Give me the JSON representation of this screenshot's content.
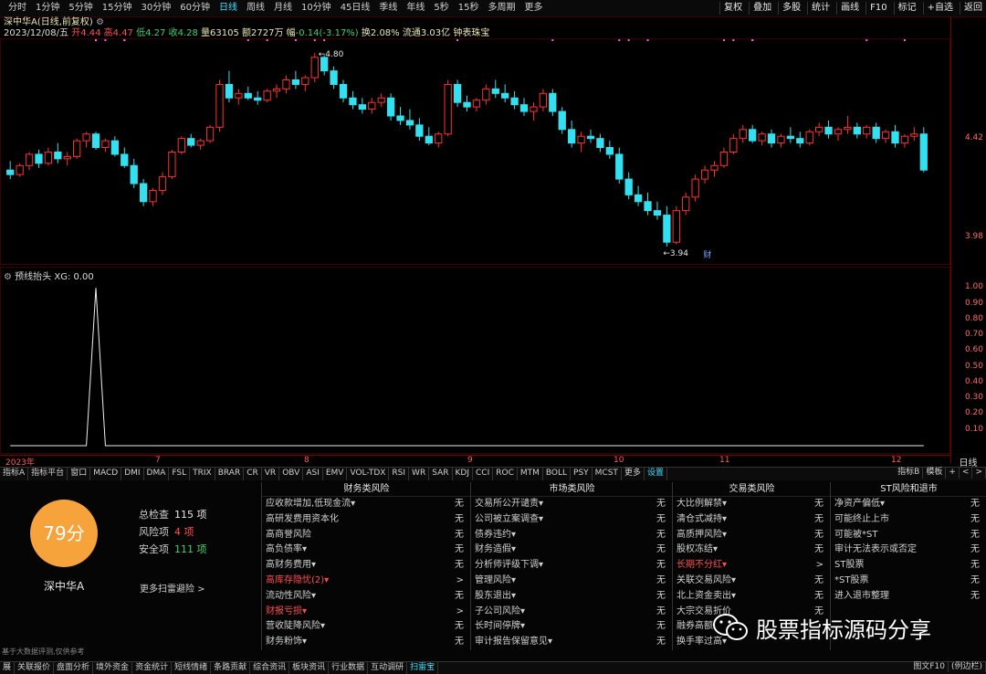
{
  "topbar": {
    "periods": [
      "分时",
      "1分钟",
      "5分钟",
      "15分钟",
      "30分钟",
      "60分钟",
      "日线",
      "周线",
      "月线",
      "10分钟",
      "45日线",
      "季线",
      "年线",
      "5秒",
      "15秒",
      "多周期",
      "更多"
    ],
    "active_period": "日线",
    "tools": [
      "复权",
      "叠加",
      "多股",
      "统计",
      "画线",
      "F10",
      "标记",
      "+自选",
      "返回"
    ]
  },
  "info": {
    "title": "深中华A(日线,前复权)",
    "date": "2023/12/08/五",
    "open_label": "开",
    "open": "4.44",
    "high_label": "高",
    "high": "4.47",
    "low_label": "低",
    "low": "4.27",
    "close_label": "收",
    "close": "4.28",
    "volume_label": "量",
    "volume": "63105",
    "amount_label": "额",
    "amount": "2727万",
    "change_label": "幅",
    "change": "-0.14(-3.17%)",
    "turnover_label": "换",
    "turnover": "2.08%",
    "float_label": "流通",
    "float": "3.03亿",
    "tag": "钟表珠宝"
  },
  "main_chart": {
    "high_marker": "4.80",
    "low_marker": "3.94",
    "fin_badge": "财",
    "y_labels": [
      "4.42",
      "3.98"
    ]
  },
  "sub_chart": {
    "title": "预线抬头",
    "xg_label": "XG: 0.00",
    "y_labels": [
      "1.00",
      "0.90",
      "0.80",
      "0.70",
      "0.60",
      "0.50",
      "0.40",
      "0.30",
      "0.20",
      "0.10"
    ]
  },
  "x_axis": {
    "labels": [
      "2023年",
      "7",
      "8",
      "9",
      "10",
      "11",
      "12"
    ],
    "right": "日线"
  },
  "indicator_tabs": {
    "items": [
      "指标A",
      "指标平台",
      "窗口",
      "MACD",
      "DMI",
      "DMA",
      "FSL",
      "TRIX",
      "BRAR",
      "CR",
      "VR",
      "OBV",
      "ASI",
      "EMV",
      "VOL-TDX",
      "RSI",
      "WR",
      "SAR",
      "KDJ",
      "CCI",
      "ROC",
      "MTM",
      "BOLL",
      "PSY",
      "MCST",
      "更多",
      "设置"
    ],
    "right": [
      "指标B",
      "模板",
      "+",
      "<",
      ">"
    ]
  },
  "risk": {
    "score": "79分",
    "name": "深中华A",
    "total_label": "总检查",
    "total": "115 项",
    "risk_label": "风险项",
    "risk_count": "4 项",
    "safe_label": "安全项",
    "safe": "111 项",
    "more": "更多扫雷避险 >",
    "disclaimer": "基于大数据评测,仅供参考",
    "columns": [
      {
        "title": "财务类风险",
        "rows": [
          {
            "name": "应收款增加,低现金流▾",
            "value": "无"
          },
          {
            "name": "高研发费用资本化",
            "value": "无"
          },
          {
            "name": "高商誉风险",
            "value": "无"
          },
          {
            "name": "高负债率▾",
            "value": "无"
          },
          {
            "name": "高财务费用▾",
            "value": "无"
          },
          {
            "name": "高库存隐忧(2)▾",
            "value": ">"
          },
          {
            "name": "流动性风险▾",
            "value": "无"
          },
          {
            "name": "财报亏损▾",
            "value": ">"
          },
          {
            "name": "营收陡降风险▾",
            "value": "无"
          },
          {
            "name": "财务粉饰▾",
            "value": "无"
          }
        ]
      },
      {
        "title": "市场类风险",
        "rows": [
          {
            "name": "交易所公开谴责▾",
            "value": "无"
          },
          {
            "name": "公司被立案调查▾",
            "value": "无"
          },
          {
            "name": "债券违约▾",
            "value": "无"
          },
          {
            "name": "财务造假▾",
            "value": "无"
          },
          {
            "name": "分析师评级下调▾",
            "value": "无"
          },
          {
            "name": "管理风险▾",
            "value": "无"
          },
          {
            "name": "股东退出▾",
            "value": "无"
          },
          {
            "name": "子公司风险▾",
            "value": "无"
          },
          {
            "name": "长时间停牌▾",
            "value": "无"
          },
          {
            "name": "审计报告保留意见▾",
            "value": "无"
          }
        ]
      },
      {
        "title": "交易类风险",
        "rows": [
          {
            "name": "大比例解禁▾",
            "value": "无"
          },
          {
            "name": "清仓式减持▾",
            "value": "无"
          },
          {
            "name": "高质押风险▾",
            "value": "无"
          },
          {
            "name": "股权冻结▾",
            "value": "无"
          },
          {
            "name": "长期不分红▾",
            "value": ">"
          },
          {
            "name": "关联交易风险▾",
            "value": "无"
          },
          {
            "name": "北上资金卖出▾",
            "value": "无"
          },
          {
            "name": "大宗交易折价",
            "value": "无"
          },
          {
            "name": "融券高额",
            "value": ""
          },
          {
            "name": "换手率过高▾",
            "value": ""
          }
        ]
      },
      {
        "title": "ST风险和退市",
        "rows": [
          {
            "name": "净资产偏低▾",
            "value": "无"
          },
          {
            "name": "可能终止上市",
            "value": "无"
          },
          {
            "name": "可能被*ST",
            "value": "无"
          },
          {
            "name": "审计无法表示或否定",
            "value": "无"
          },
          {
            "name": "ST股票",
            "value": "无"
          },
          {
            "name": "*ST股票",
            "value": "无"
          },
          {
            "name": "进入退市整理",
            "value": "无"
          },
          {
            "name": "",
            "value": ""
          },
          {
            "name": "",
            "value": ""
          },
          {
            "name": "",
            "value": ""
          }
        ]
      }
    ]
  },
  "watermark": "股票指标源码分享",
  "bottom_bar": {
    "items": [
      "展",
      "关联报价",
      "盘面分析",
      "境外资金",
      "资金统计",
      "短线情绪",
      "条路贡献",
      "综合资讯",
      "板块资讯",
      "行业数据",
      "互动调研",
      "扫雷宝"
    ],
    "active": "扫雷宝",
    "right": [
      "图文F10",
      "(例边栏)"
    ]
  },
  "colors": {
    "up": "#ff3030",
    "down": "#33e0f0",
    "accent": "#3ce0ff",
    "score_bg": "#f5a33a"
  },
  "chart_data": {
    "type": "candlestick",
    "candles": [
      [
        4.28,
        4.32,
        4.24,
        4.26
      ],
      [
        4.26,
        4.31,
        4.25,
        4.3
      ],
      [
        4.3,
        4.36,
        4.28,
        4.35
      ],
      [
        4.35,
        4.37,
        4.29,
        4.31
      ],
      [
        4.31,
        4.38,
        4.3,
        4.36
      ],
      [
        4.36,
        4.4,
        4.31,
        4.33
      ],
      [
        4.33,
        4.36,
        4.3,
        4.34
      ],
      [
        4.34,
        4.42,
        4.33,
        4.41
      ],
      [
        4.41,
        4.45,
        4.38,
        4.44
      ],
      [
        4.44,
        4.45,
        4.37,
        4.38
      ],
      [
        4.38,
        4.42,
        4.36,
        4.41
      ],
      [
        4.41,
        4.43,
        4.34,
        4.35
      ],
      [
        4.35,
        4.38,
        4.29,
        4.3
      ],
      [
        4.3,
        4.33,
        4.2,
        4.22
      ],
      [
        4.22,
        4.24,
        4.12,
        4.14
      ],
      [
        4.14,
        4.2,
        4.12,
        4.19
      ],
      [
        4.19,
        4.27,
        4.17,
        4.25
      ],
      [
        4.25,
        4.37,
        4.24,
        4.36
      ],
      [
        4.36,
        4.43,
        4.35,
        4.42
      ],
      [
        4.42,
        4.44,
        4.38,
        4.39
      ],
      [
        4.39,
        4.42,
        4.37,
        4.41
      ],
      [
        4.41,
        4.48,
        4.4,
        4.47
      ],
      [
        4.47,
        4.68,
        4.45,
        4.66
      ],
      [
        4.66,
        4.72,
        4.58,
        4.6
      ],
      [
        4.6,
        4.64,
        4.57,
        4.62
      ],
      [
        4.62,
        4.65,
        4.59,
        4.6
      ],
      [
        4.6,
        4.63,
        4.57,
        4.59
      ],
      [
        4.59,
        4.64,
        4.58,
        4.63
      ],
      [
        4.63,
        4.66,
        4.6,
        4.64
      ],
      [
        4.64,
        4.7,
        4.62,
        4.68
      ],
      [
        4.68,
        4.72,
        4.64,
        4.66
      ],
      [
        4.66,
        4.7,
        4.63,
        4.69
      ],
      [
        4.69,
        4.8,
        4.67,
        4.78
      ],
      [
        4.78,
        4.79,
        4.7,
        4.72
      ],
      [
        4.72,
        4.74,
        4.64,
        4.66
      ],
      [
        4.66,
        4.68,
        4.58,
        4.6
      ],
      [
        4.6,
        4.63,
        4.55,
        4.57
      ],
      [
        4.57,
        4.6,
        4.53,
        4.55
      ],
      [
        4.55,
        4.6,
        4.53,
        4.58
      ],
      [
        4.58,
        4.62,
        4.56,
        4.6
      ],
      [
        4.6,
        4.62,
        4.5,
        4.52
      ],
      [
        4.52,
        4.56,
        4.48,
        4.5
      ],
      [
        4.5,
        4.55,
        4.46,
        4.48
      ],
      [
        4.48,
        4.51,
        4.41,
        4.43
      ],
      [
        4.43,
        4.47,
        4.39,
        4.4
      ],
      [
        4.4,
        4.45,
        4.38,
        4.44
      ],
      [
        4.44,
        4.68,
        4.43,
        4.66
      ],
      [
        4.66,
        4.68,
        4.56,
        4.58
      ],
      [
        4.58,
        4.61,
        4.54,
        4.56
      ],
      [
        4.56,
        4.6,
        4.54,
        4.59
      ],
      [
        4.59,
        4.66,
        4.57,
        4.64
      ],
      [
        4.64,
        4.68,
        4.6,
        4.62
      ],
      [
        4.62,
        4.66,
        4.58,
        4.6
      ],
      [
        4.6,
        4.63,
        4.55,
        4.57
      ],
      [
        4.57,
        4.6,
        4.52,
        4.54
      ],
      [
        4.54,
        4.58,
        4.5,
        4.56
      ],
      [
        4.56,
        4.64,
        4.54,
        4.62
      ],
      [
        4.62,
        4.64,
        4.52,
        4.54
      ],
      [
        4.54,
        4.56,
        4.44,
        4.46
      ],
      [
        4.46,
        4.5,
        4.38,
        4.4
      ],
      [
        4.4,
        4.45,
        4.36,
        4.43
      ],
      [
        4.43,
        4.46,
        4.4,
        4.42
      ],
      [
        4.42,
        4.44,
        4.36,
        4.38
      ],
      [
        4.38,
        4.41,
        4.33,
        4.35
      ],
      [
        4.35,
        4.38,
        4.22,
        4.24
      ],
      [
        4.24,
        4.27,
        4.15,
        4.17
      ],
      [
        4.17,
        4.21,
        4.12,
        4.14
      ],
      [
        4.14,
        4.18,
        4.08,
        4.1
      ],
      [
        4.1,
        4.14,
        4.06,
        4.08
      ],
      [
        4.08,
        4.12,
        3.94,
        3.96
      ],
      [
        3.96,
        4.12,
        3.95,
        4.1
      ],
      [
        4.1,
        4.18,
        4.08,
        4.16
      ],
      [
        4.16,
        4.26,
        4.14,
        4.24
      ],
      [
        4.24,
        4.3,
        4.22,
        4.28
      ],
      [
        4.28,
        4.32,
        4.25,
        4.3
      ],
      [
        4.3,
        4.38,
        4.29,
        4.36
      ],
      [
        4.36,
        4.44,
        4.35,
        4.42
      ],
      [
        4.42,
        4.48,
        4.4,
        4.46
      ],
      [
        4.46,
        4.48,
        4.4,
        4.41
      ],
      [
        4.41,
        4.45,
        4.39,
        4.44
      ],
      [
        4.44,
        4.46,
        4.38,
        4.4
      ],
      [
        4.4,
        4.44,
        4.38,
        4.43
      ],
      [
        4.43,
        4.47,
        4.4,
        4.42
      ],
      [
        4.42,
        4.45,
        4.38,
        4.4
      ],
      [
        4.4,
        4.46,
        4.39,
        4.45
      ],
      [
        4.45,
        4.49,
        4.43,
        4.47
      ],
      [
        4.47,
        4.5,
        4.42,
        4.44
      ],
      [
        4.44,
        4.47,
        4.41,
        4.46
      ],
      [
        4.46,
        4.52,
        4.44,
        4.47
      ],
      [
        4.47,
        4.49,
        4.42,
        4.44
      ],
      [
        4.44,
        4.48,
        4.42,
        4.47
      ],
      [
        4.47,
        4.49,
        4.4,
        4.42
      ],
      [
        4.42,
        4.46,
        4.4,
        4.45
      ],
      [
        4.45,
        4.48,
        4.38,
        4.4
      ],
      [
        4.4,
        4.44,
        4.38,
        4.43
      ],
      [
        4.43,
        4.47,
        4.41,
        4.44
      ],
      [
        4.44,
        4.47,
        4.27,
        4.28
      ]
    ],
    "ylim": [
      3.9,
      4.84
    ],
    "sub_series": {
      "spike_index": 9,
      "ylim": [
        0,
        1.1
      ]
    }
  }
}
